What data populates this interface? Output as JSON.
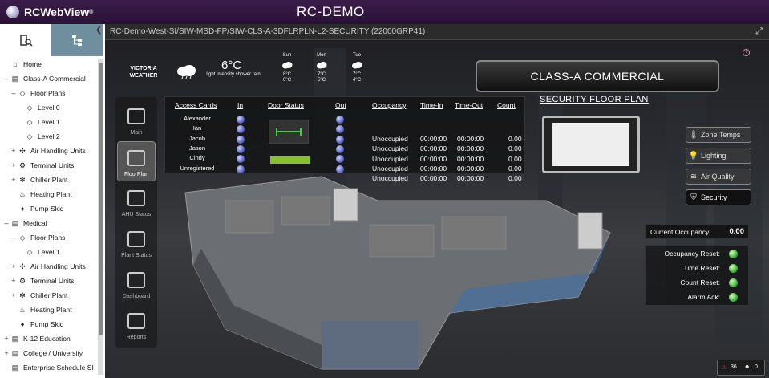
{
  "app": {
    "logo_text": "RCWebView",
    "logo_tm": "®",
    "title": "RC-DEMO"
  },
  "sidebar": {
    "collapse_icon": "chevron-left-icon",
    "tree": [
      {
        "label": "Home",
        "icon": "home-icon",
        "level": 0,
        "expander": ""
      },
      {
        "label": "Class-A Commercial",
        "icon": "building-icon",
        "level": 0,
        "expander": "–"
      },
      {
        "label": "Floor Plans",
        "icon": "floorplan-icon",
        "level": 1,
        "expander": "–"
      },
      {
        "label": "Level 0",
        "icon": "floorplan-icon",
        "level": 2,
        "expander": ""
      },
      {
        "label": "Level 1",
        "icon": "floorplan-icon",
        "level": 2,
        "expander": ""
      },
      {
        "label": "Level 2",
        "icon": "floorplan-icon",
        "level": 2,
        "expander": ""
      },
      {
        "label": "Air Handling Units",
        "icon": "fan-icon",
        "level": 1,
        "expander": "+"
      },
      {
        "label": "Terminal Units",
        "icon": "gear-icon",
        "level": 1,
        "expander": "+"
      },
      {
        "label": "Chiller Plant",
        "icon": "snowflake-icon",
        "level": 1,
        "expander": "+"
      },
      {
        "label": "Heating Plant",
        "icon": "flame-icon",
        "level": 1,
        "expander": ""
      },
      {
        "label": "Pump Skid",
        "icon": "drop-icon",
        "level": 1,
        "expander": ""
      },
      {
        "label": "Medical",
        "icon": "building-icon",
        "level": 0,
        "expander": "–"
      },
      {
        "label": "Floor Plans",
        "icon": "floorplan-icon",
        "level": 1,
        "expander": "–"
      },
      {
        "label": "Level 1",
        "icon": "floorplan-icon",
        "level": 2,
        "expander": ""
      },
      {
        "label": "Air Handling Units",
        "icon": "fan-icon",
        "level": 1,
        "expander": "+"
      },
      {
        "label": "Terminal Units",
        "icon": "gear-icon",
        "level": 1,
        "expander": "+"
      },
      {
        "label": "Chiller Plant",
        "icon": "snowflake-icon",
        "level": 1,
        "expander": "+"
      },
      {
        "label": "Heating Plant",
        "icon": "flame-icon",
        "level": 1,
        "expander": ""
      },
      {
        "label": "Pump Skid",
        "icon": "drop-icon",
        "level": 1,
        "expander": ""
      },
      {
        "label": "K-12 Education",
        "icon": "building-icon",
        "level": 0,
        "expander": "+"
      },
      {
        "label": "College / University",
        "icon": "building-icon",
        "level": 0,
        "expander": "+"
      },
      {
        "label": "Enterprise Schedule SI",
        "icon": "building-icon",
        "level": 0,
        "expander": ""
      }
    ]
  },
  "breadcrumb": "RC-Demo-West-SI/SIW-MSD-FP/SIW-CLS-A-3DFLRPLN-L2-SECURITY (22000GRP41)",
  "weather": {
    "name": "VICTORIA WEATHER",
    "temp": "6°C",
    "condition": "light intensity shower rain",
    "forecast": [
      {
        "day": "Sun",
        "high": "8°C",
        "low": "6°C"
      },
      {
        "day": "Mon",
        "high": "7°C",
        "low": "5°C"
      },
      {
        "day": "Tue",
        "high": "7°C",
        "low": "4°C"
      }
    ]
  },
  "banner": {
    "title": "CLASS-A COMMERCIAL",
    "subtitle": "SECURITY FLOOR PLAN"
  },
  "nav": [
    {
      "label": "Main",
      "icon": "building-icon"
    },
    {
      "label": "FloorPlan",
      "icon": "floorplan-icon"
    },
    {
      "label": "AHU Status",
      "icon": "fan-icon"
    },
    {
      "label": "Plant Status",
      "icon": "plant-icon"
    },
    {
      "label": "Dashboard",
      "icon": "bar-chart-icon"
    },
    {
      "label": "Reports",
      "icon": "list-icon"
    }
  ],
  "access": {
    "headers": {
      "cards": "Access Cards",
      "in": "In",
      "door": "Door Status",
      "out": "Out",
      "occupancy": "Occupancy",
      "time_in": "Time-In",
      "time_out": "Time-Out",
      "count": "Count"
    },
    "names": [
      "Alexander",
      "Ian",
      "Jacob",
      "Jason",
      "Cindy",
      "Unregistered"
    ],
    "rows": [
      {
        "occupancy": "Unoccupied",
        "time_in": "00:00:00",
        "time_out": "00:00:00",
        "count": "0.00"
      },
      {
        "occupancy": "Unoccupied",
        "time_in": "00:00:00",
        "time_out": "00:00:00",
        "count": "0.00"
      },
      {
        "occupancy": "Unoccupied",
        "time_in": "00:00:00",
        "time_out": "00:00:00",
        "count": "0.00"
      },
      {
        "occupancy": "Unoccupied",
        "time_in": "00:00:00",
        "time_out": "00:00:00",
        "count": "0.00"
      },
      {
        "occupancy": "Unoccupied",
        "time_in": "00:00:00",
        "time_out": "00:00:00",
        "count": "0.00"
      }
    ]
  },
  "right_nav": [
    {
      "label": "Zone Temps",
      "icon": "thermometer-icon",
      "active": false
    },
    {
      "label": "Lighting",
      "icon": "bulb-icon",
      "active": false
    },
    {
      "label": "Air Quality",
      "icon": "air-quality-icon",
      "active": false
    },
    {
      "label": "Security",
      "icon": "shield-lock-icon",
      "active": true
    }
  ],
  "occupancy": {
    "label": "Current Occupancy:",
    "value": "0.00"
  },
  "resets": [
    {
      "label": "Occupancy Reset:"
    },
    {
      "label": "Time Reset:"
    },
    {
      "label": "Count Reset:"
    },
    {
      "label": "Alarm Ack:"
    }
  ],
  "status_tray": {
    "alarms": "36",
    "users": "0"
  }
}
